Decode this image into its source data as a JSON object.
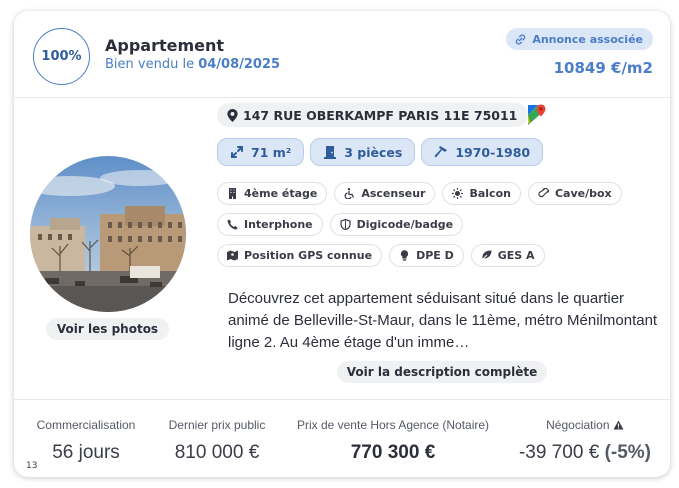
{
  "header": {
    "score": "100%",
    "title": "Appartement",
    "sold_prefix": "Bien vendu le ",
    "sold_date": "04/08/2025",
    "linked_badge": "Annonce associée",
    "price_per_m2": "10849 €/m2"
  },
  "address": "147 RUE OBERKAMPF PARIS 11E 75011",
  "main_chips": [
    {
      "icon": "expand-arrows-icon",
      "label": "71 m²"
    },
    {
      "icon": "door-icon",
      "label": "3 pièces"
    },
    {
      "icon": "hammer-icon",
      "label": "1970-1980"
    }
  ],
  "features": [
    {
      "icon": "building-icon",
      "label": "4ème étage"
    },
    {
      "icon": "wheelchair-icon",
      "label": "Ascenseur"
    },
    {
      "icon": "sun-icon",
      "label": "Balcon"
    },
    {
      "icon": "bottle-icon",
      "label": "Cave/box"
    },
    {
      "icon": "phone-icon",
      "label": "Interphone"
    },
    {
      "icon": "shield-icon",
      "label": "Digicode/badge"
    },
    {
      "icon": "map-marker-icon",
      "label": "Position GPS connue"
    },
    {
      "icon": "bulb-icon",
      "label": "DPE D"
    },
    {
      "icon": "leaf-icon",
      "label": "GES A"
    }
  ],
  "photo_button": "Voir les photos",
  "description": "Découvrez cet appartement séduisant situé dans le quartier animé de Belleville-St-Maur, dans le 11ème, métro Ménilmontant ligne 2. Au 4ème étage d'un imme…",
  "description_button": "Voir la description complète",
  "stats": {
    "commercialisation": {
      "label": "Commercialisation",
      "value": "56 jours"
    },
    "dernier_prix": {
      "label": "Dernier prix public",
      "value": "810 000 €"
    },
    "prix_vente": {
      "label": "Prix de vente Hors Agence (Notaire)",
      "value": "770 300 €"
    },
    "negociation": {
      "label": "Négociation",
      "value": "-39 700 €",
      "percent": "(-5%)"
    }
  },
  "footnote": "13",
  "colors": {
    "accent": "#4a7ec7",
    "chip_bg": "#dbe6f6",
    "neutral_bg": "#f0f1f3"
  }
}
